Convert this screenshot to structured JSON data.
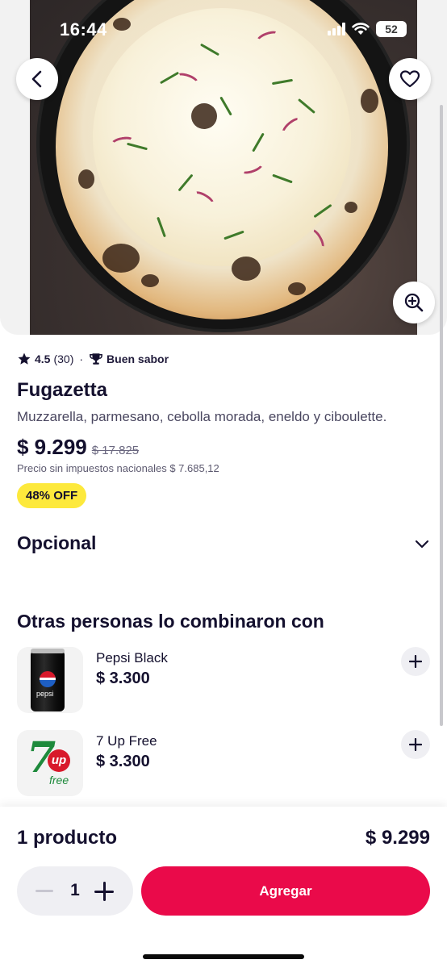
{
  "status_bar": {
    "time": "16:44",
    "battery": "52"
  },
  "hero": {
    "back_icon": "chevron-left-icon",
    "favorite_icon": "heart-outline-icon",
    "zoom_icon": "zoom-in-icon"
  },
  "product": {
    "rating": "4.5",
    "rating_count": "(30)",
    "separator": "·",
    "tag": "Buen sabor",
    "title": "Fugazetta",
    "description": "Muzzarella, parmesano, cebolla morada, eneldo y ciboulette.",
    "price": "$ 9.299",
    "old_price": "$ 17.825",
    "tax_note": "Precio sin impuestos nacionales $ 7.685,12",
    "discount": "48% OFF"
  },
  "options": {
    "title": "Opcional"
  },
  "combos": {
    "title": "Otras personas lo combinaron con",
    "items": [
      {
        "name": "Pepsi Black",
        "price": "$ 3.300",
        "image": "pepsi-can",
        "image_text": "pepsi"
      },
      {
        "name": "7 Up Free",
        "price": "$ 3.300",
        "image": "7up-logo",
        "image_text_main": "7",
        "image_text_up": "up",
        "image_text_free": "free"
      }
    ]
  },
  "cart": {
    "count_label": "1 producto",
    "total": "$ 9.299",
    "quantity": "1",
    "add_label": "Agregar"
  },
  "colors": {
    "accent": "#ea0a4a",
    "discount_bg": "#fde93c",
    "text_primary": "#14102e"
  }
}
